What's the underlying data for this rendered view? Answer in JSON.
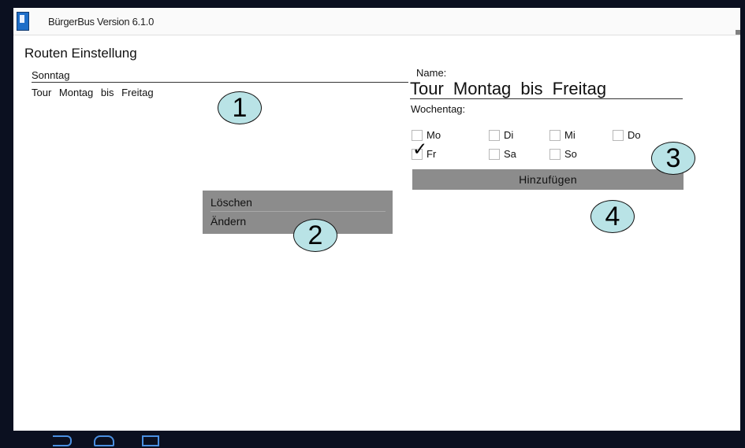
{
  "app": {
    "title": "BürgerBus Version 6.1.0"
  },
  "page": {
    "heading": "Routen Einstellung"
  },
  "route_list": {
    "header": "Sonntag",
    "items": [
      "Tour Montag  bis  Freitag"
    ]
  },
  "context_menu": {
    "items": [
      "Löschen",
      "Ändern"
    ]
  },
  "form": {
    "name_label": "Name:",
    "name_value": "Tour Montag  bis  Freitag",
    "weekday_label": "Wochentag:",
    "days": [
      {
        "label": "Mo",
        "checked": false
      },
      {
        "label": "Di",
        "checked": false
      },
      {
        "label": "Mi",
        "checked": false
      },
      {
        "label": "Do",
        "checked": false
      },
      {
        "label": "Fr",
        "checked": true
      },
      {
        "label": "Sa",
        "checked": false
      },
      {
        "label": "So",
        "checked": false
      }
    ],
    "add_button": "Hinzufügen"
  },
  "annotations": [
    "1",
    "2",
    "3",
    "4"
  ],
  "navbar": {
    "icons": [
      "back-icon",
      "home-icon",
      "recent-apps-icon"
    ]
  },
  "colors": {
    "frame": "#0b1020",
    "menu_bg": "#8c8c8c",
    "badge_fill": "#b9e3e6",
    "nav_icon": "#4a8fe0"
  }
}
